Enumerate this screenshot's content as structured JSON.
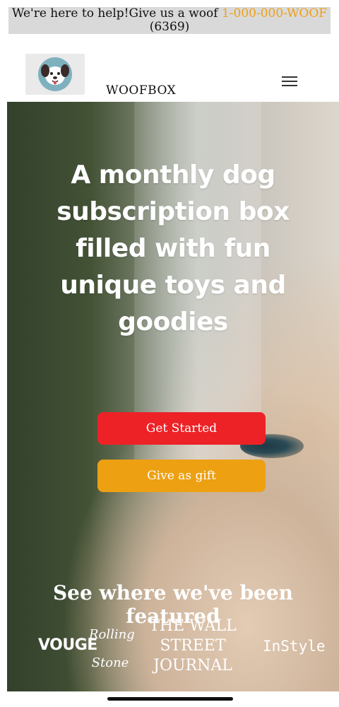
{
  "topbar": {
    "help_text": "We're here to help!Give us a woof ",
    "phone_word": "1-000-000-WOOF",
    "phone_digits": " (6369)",
    "accent_color": "#f0a015"
  },
  "header": {
    "logo_icon": "dog-face-logo",
    "brand": "WOOFBOX",
    "menu_icon": "hamburger-icon"
  },
  "hero": {
    "headline": "A monthly dog subscription box filled with fun unique toys and goodies",
    "primary_cta": "Get Started",
    "secondary_cta": "Give as gift",
    "primary_color": "#ec2227",
    "secondary_color": "#eda012"
  },
  "featured": {
    "title": "See where we've been featured",
    "logos": {
      "vouge": "VOUGE",
      "rolling_line1": "Rolling",
      "rolling_line2": "Stone",
      "wsj_line1": "THE WALL",
      "wsj_line2": "STREET",
      "wsj_line3": "JOURNAL",
      "instyle": "InStyle"
    }
  }
}
